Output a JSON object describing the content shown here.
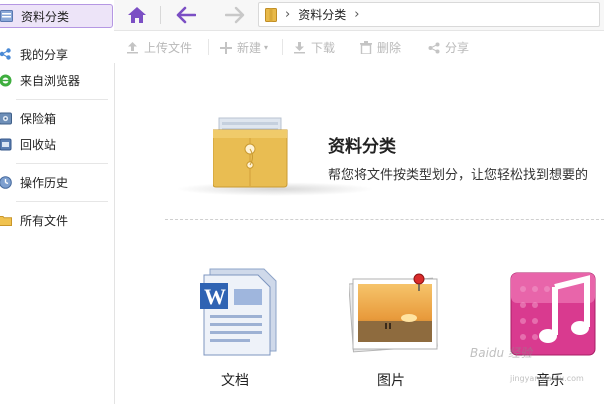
{
  "sidebar": {
    "items": [
      {
        "label": "资料分类",
        "icon": "category-icon"
      },
      {
        "label": "我的分享",
        "icon": "share-icon"
      },
      {
        "label": "来自浏览器",
        "icon": "browser-icon"
      },
      {
        "label": "保险箱",
        "icon": "safe-icon"
      },
      {
        "label": "回收站",
        "icon": "recycle-bin-icon"
      },
      {
        "label": "操作历史",
        "icon": "history-icon"
      },
      {
        "label": "所有文件",
        "icon": "folder-icon"
      }
    ]
  },
  "nav": {
    "breadcrumb": "资料分类"
  },
  "toolbar": {
    "upload": "上传文件",
    "new": "新建",
    "download": "下载",
    "delete": "删除",
    "share": "分享"
  },
  "main": {
    "title": "资料分类",
    "description": "帮您将文件按类型划分，让您轻松找到想要的",
    "categories": [
      {
        "label": "文档",
        "icon": "document-icon"
      },
      {
        "label": "图片",
        "icon": "picture-icon"
      },
      {
        "label": "音乐",
        "icon": "music-icon"
      }
    ]
  },
  "watermark": {
    "text": "Baidu 经验",
    "url": "jingyan.baidu.com"
  },
  "colors": {
    "accent": "#7b4fc4",
    "active_bg": "#ede4f8",
    "active_border": "#b597e3",
    "folder": "#e8b949",
    "music": "#d93a8f"
  }
}
